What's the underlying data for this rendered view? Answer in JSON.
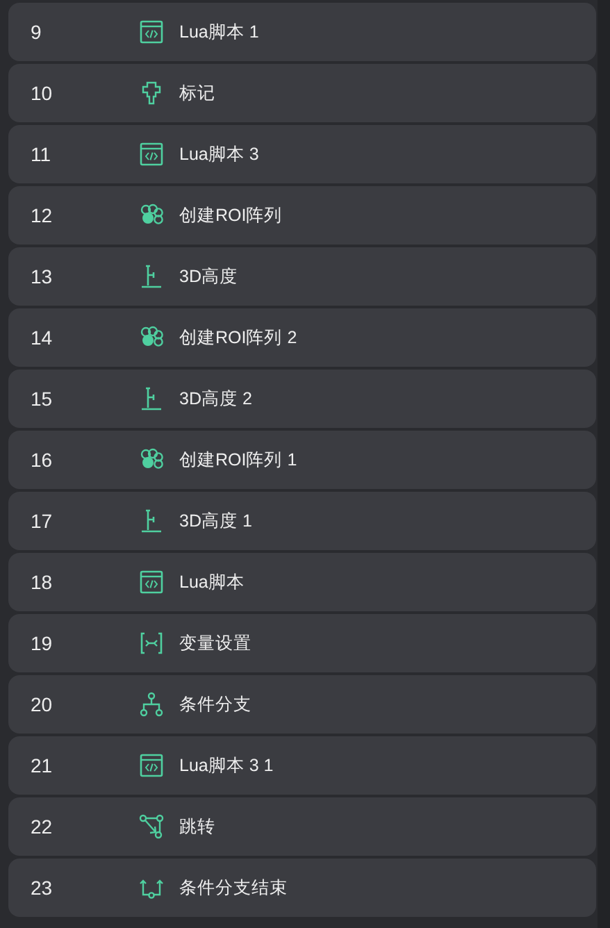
{
  "steps": [
    {
      "number": "9",
      "kind": "script",
      "label": "Lua脚本 1"
    },
    {
      "number": "10",
      "kind": "marker",
      "label": "标记"
    },
    {
      "number": "11",
      "kind": "script",
      "label": "Lua脚本 3"
    },
    {
      "number": "12",
      "kind": "roi-array",
      "label": "创建ROI阵列"
    },
    {
      "number": "13",
      "kind": "height3d",
      "label": "3D高度"
    },
    {
      "number": "14",
      "kind": "roi-array",
      "label": "创建ROI阵列 2"
    },
    {
      "number": "15",
      "kind": "height3d",
      "label": "3D高度 2"
    },
    {
      "number": "16",
      "kind": "roi-array",
      "label": "创建ROI阵列 1"
    },
    {
      "number": "17",
      "kind": "height3d",
      "label": "3D高度 1"
    },
    {
      "number": "18",
      "kind": "script",
      "label": "Lua脚本"
    },
    {
      "number": "19",
      "kind": "variable",
      "label": "变量设置"
    },
    {
      "number": "20",
      "kind": "branch",
      "label": "条件分支"
    },
    {
      "number": "21",
      "kind": "script",
      "label": "Lua脚本 3 1"
    },
    {
      "number": "22",
      "kind": "jump",
      "label": "跳转"
    },
    {
      "number": "23",
      "kind": "branch-end",
      "label": "条件分支结束"
    }
  ]
}
